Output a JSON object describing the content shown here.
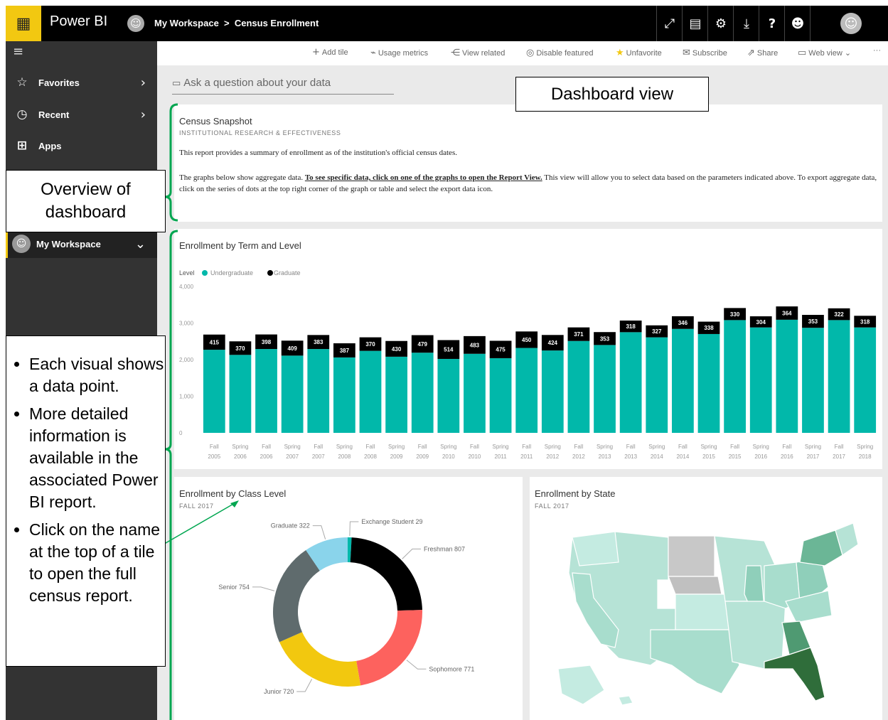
{
  "topbar": {
    "app_name": "Power BI",
    "breadcrumb": "My Workspace  >  Census Enrollment",
    "icons": [
      "expand-icon",
      "comment-icon",
      "gear-icon",
      "download-icon",
      "help-icon",
      "smiley-icon"
    ]
  },
  "sidebar": {
    "items": [
      {
        "label": "Favorites",
        "icon": "star-icon"
      },
      {
        "label": "Recent",
        "icon": "clock-icon"
      },
      {
        "label": "Apps",
        "icon": "apps-icon"
      }
    ],
    "workspace_label": "My Workspace"
  },
  "actionbar": {
    "add_tile": "Add tile",
    "usage_metrics": "Usage metrics",
    "view_related": "View related",
    "disable_featured": "Disable featured",
    "unfavorite": "Unfavorite",
    "subscribe": "Subscribe",
    "share": "Share",
    "web_view": "Web view",
    "more": "···"
  },
  "qna": {
    "placeholder": "Ask a question about your data"
  },
  "snapshot": {
    "title": "Census Snapshot",
    "subtitle": "INSTITUTIONAL RESEARCH & EFFECTIVENESS",
    "para1": "This report provides a summary of enrollment as of the institution's official census dates.",
    "para2_a": "The graphs below show aggregate data. ",
    "para2_link": "To see specific data, click on one of the graphs to open the Report View.",
    "para2_b": " This view will allow you to select data based on the parameters indicated above. To export aggregate data, click on the series of dots at the top right corner of the graph or table and select the export data icon."
  },
  "enrollment_tile": {
    "title": "Enrollment by Term and Level"
  },
  "class_tile": {
    "title": "Enrollment by Class Level",
    "subtitle": "FALL 2017"
  },
  "state_tile": {
    "title": "Enrollment by State",
    "subtitle": "FALL 2017"
  },
  "callouts": {
    "dashboard_view": "Dashboard view",
    "overview_l1": "Overview of",
    "overview_l2": "dashboard",
    "bullet1": "Each visual shows a data point.",
    "bullet2": "More detailed information is available in the associated Power BI report.",
    "bullet3": "Click on the name at the top of a tile to open the full census report."
  },
  "colors": {
    "undergraduate": "#01b8aa",
    "graduate": "#000000",
    "accent": "#f2c811",
    "bracket": "#00a650"
  },
  "chart_data": [
    {
      "type": "bar",
      "title": "Enrollment by Term and Level",
      "legend_title": "Level",
      "legend_position": "top-left",
      "categories": [
        [
          "Fall",
          "2005"
        ],
        [
          "Spring",
          "2006"
        ],
        [
          "Fall",
          "2006"
        ],
        [
          "Spring",
          "2007"
        ],
        [
          "Fall",
          "2007"
        ],
        [
          "Spring",
          "2008"
        ],
        [
          "Fall",
          "2008"
        ],
        [
          "Spring",
          "2009"
        ],
        [
          "Fall",
          "2009"
        ],
        [
          "Spring",
          "2010"
        ],
        [
          "Fall",
          "2010"
        ],
        [
          "Spring",
          "2011"
        ],
        [
          "Fall",
          "2011"
        ],
        [
          "Spring",
          "2012"
        ],
        [
          "Fall",
          "2012"
        ],
        [
          "Spring",
          "2013"
        ],
        [
          "Fall",
          "2013"
        ],
        [
          "Spring",
          "2014"
        ],
        [
          "Fall",
          "2014"
        ],
        [
          "Spring",
          "2015"
        ],
        [
          "Fall",
          "2015"
        ],
        [
          "Spring",
          "2016"
        ],
        [
          "Fall",
          "2016"
        ],
        [
          "Spring",
          "2017"
        ],
        [
          "Fall",
          "2017"
        ],
        [
          "Spring",
          "2018"
        ]
      ],
      "series": [
        {
          "name": "Undergraduate",
          "color": "#01b8aa",
          "values": [
            2270,
            2130,
            2290,
            2110,
            2290,
            2060,
            2240,
            2080,
            2190,
            2020,
            2160,
            2040,
            2320,
            2250,
            2510,
            2400,
            2750,
            2610,
            2840,
            2700,
            3080,
            2880,
            3090,
            2870,
            3080,
            2880
          ]
        },
        {
          "name": "Graduate",
          "color": "#000000",
          "values": [
            415,
            370,
            398,
            409,
            383,
            387,
            370,
            430,
            479,
            514,
            483,
            475,
            450,
            424,
            371,
            353,
            318,
            327,
            346,
            338,
            330,
            304,
            364,
            353,
            322,
            318
          ]
        }
      ],
      "stacked": true,
      "ylim": [
        0,
        4000
      ],
      "yticks": [
        0,
        1000,
        2000,
        3000,
        4000
      ],
      "ytick_labels": [
        "0",
        "1,000",
        "2,000",
        "3,000",
        "4,000"
      ],
      "data_labels": "graduate values"
    },
    {
      "type": "pie",
      "donut": true,
      "title": "Enrollment by Class Level",
      "slices": [
        {
          "label": "Exchange Student",
          "value": 29,
          "color": "#01b8aa"
        },
        {
          "label": "Freshman",
          "value": 807,
          "color": "#000000"
        },
        {
          "label": "Sophomore",
          "value": 771,
          "color": "#fd625e"
        },
        {
          "label": "Junior",
          "value": 720,
          "color": "#f2c80f"
        },
        {
          "label": "Senior",
          "value": 754,
          "color": "#5f6b6d"
        },
        {
          "label": "Graduate",
          "value": 322,
          "color": "#8ad4eb"
        }
      ]
    }
  ]
}
